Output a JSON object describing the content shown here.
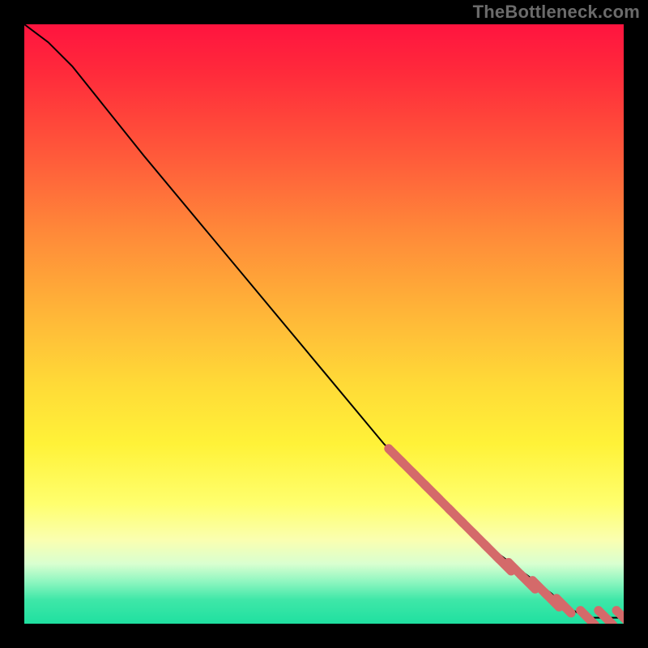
{
  "watermark": "TheBottleneck.com",
  "colors": {
    "marker": "#d46a6a",
    "line": "#000000",
    "bg_black": "#000000"
  },
  "chart_data": {
    "type": "line",
    "title": "",
    "xlabel": "",
    "ylabel": "",
    "xlim": [
      0,
      100
    ],
    "ylim": [
      0,
      100
    ],
    "grid": false,
    "legend": false,
    "series": [
      {
        "name": "curve",
        "x": [
          0,
          4,
          8,
          12,
          20,
          30,
          40,
          50,
          60,
          68,
          72,
          76,
          80,
          84,
          88,
          90,
          92,
          94,
          96,
          98,
          100
        ],
        "y": [
          100,
          97,
          93,
          88,
          78,
          66,
          54,
          42,
          30,
          22,
          18,
          14,
          11,
          8,
          5,
          3,
          2,
          1,
          1,
          1,
          1
        ]
      }
    ],
    "markers": {
      "name": "cluster",
      "x": [
        62,
        64,
        66,
        68,
        70,
        72,
        74,
        76,
        78,
        80,
        82,
        84,
        86,
        88,
        90,
        94,
        97,
        100
      ],
      "y": [
        28,
        26,
        24,
        22,
        20,
        18,
        16,
        14,
        12,
        10,
        9,
        7,
        6,
        4,
        3,
        1,
        1,
        1
      ]
    }
  }
}
